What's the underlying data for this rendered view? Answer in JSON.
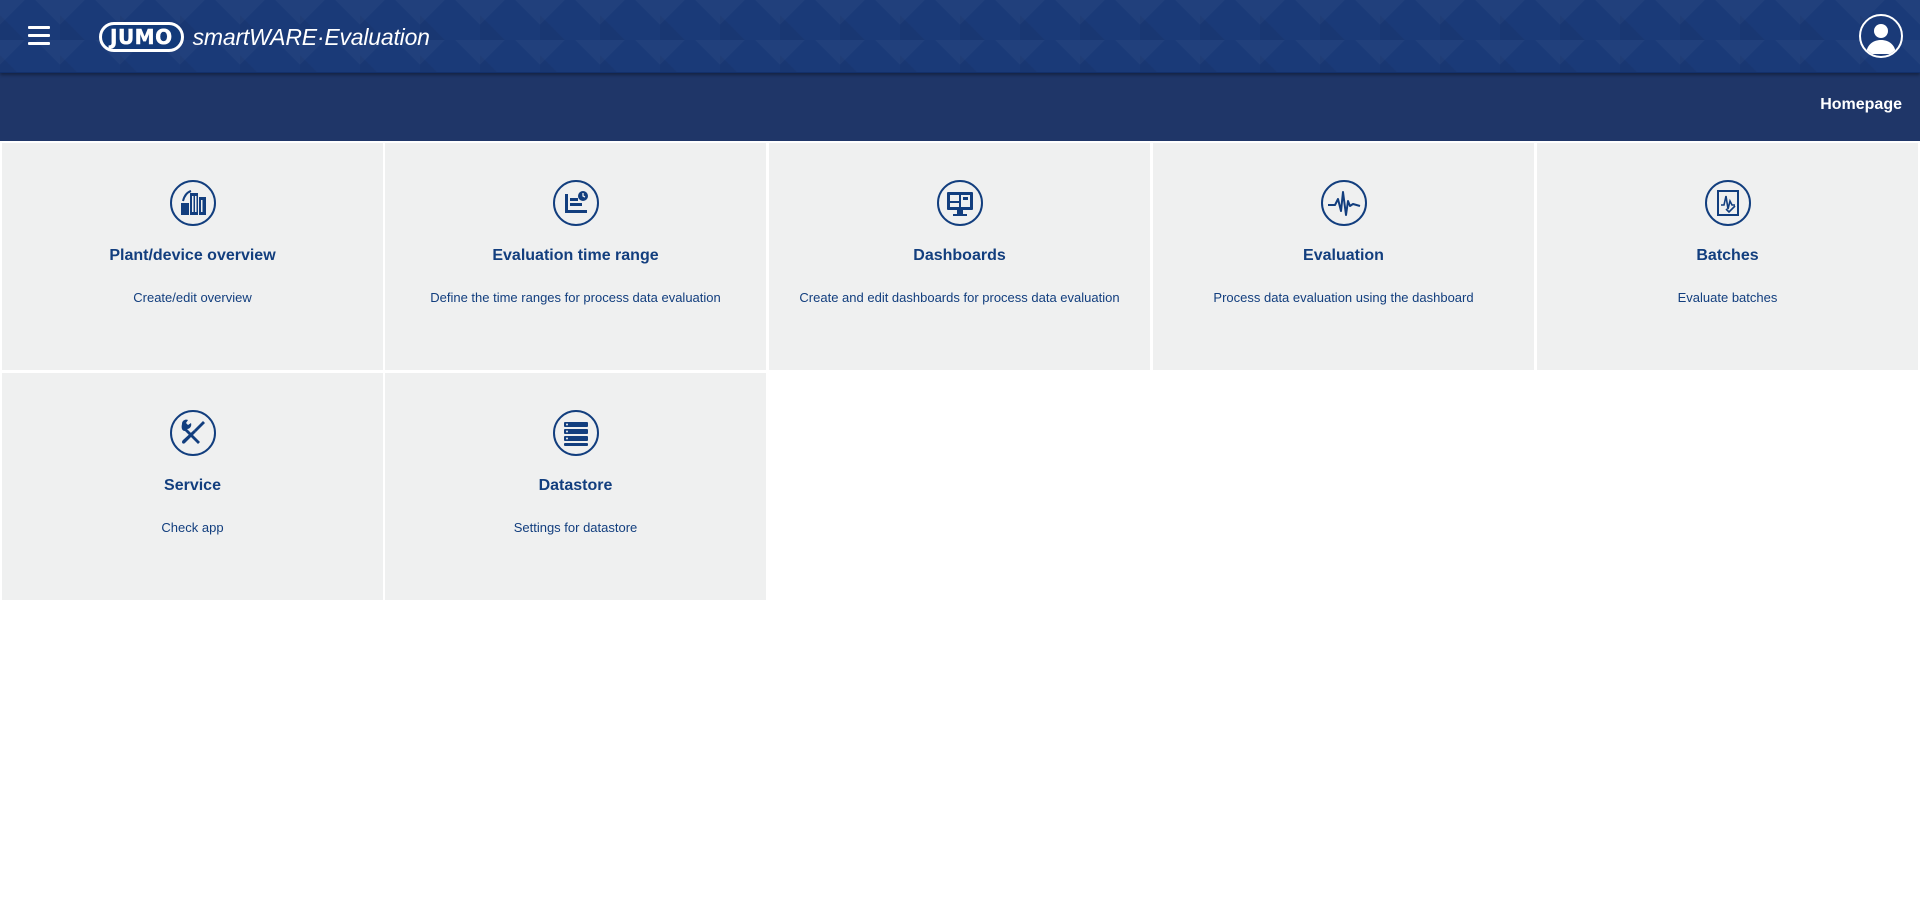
{
  "header": {
    "logo_badge": "JUMO",
    "logo_text": "smartWARE·Evaluation",
    "menu_icon": "hamburger-menu-icon",
    "avatar_icon": "user-avatar-icon"
  },
  "subheader": {
    "title": "Homepage"
  },
  "tiles": [
    {
      "title": "Plant/device overview",
      "description": "Create/edit overview",
      "icon": "plant-icon"
    },
    {
      "title": "Evaluation time range",
      "description": "Define the time ranges for process data evaluation",
      "icon": "time-range-icon"
    },
    {
      "title": "Dashboards",
      "description": "Create and edit dashboards for process data evaluation",
      "icon": "monitor-icon"
    },
    {
      "title": "Evaluation",
      "description": "Process data evaluation using the dashboard",
      "icon": "waveform-icon"
    },
    {
      "title": "Batches",
      "description": "Evaluate batches",
      "icon": "batch-chart-icon"
    },
    {
      "title": "Service",
      "description": "Check app",
      "icon": "tools-icon"
    },
    {
      "title": "Datastore",
      "description": "Settings for datastore",
      "icon": "database-icon"
    }
  ],
  "colors": {
    "topbar": "#1a3a78",
    "subheader": "#1f3668",
    "tile_bg": "#eff0f0",
    "accent": "#123e7e"
  }
}
